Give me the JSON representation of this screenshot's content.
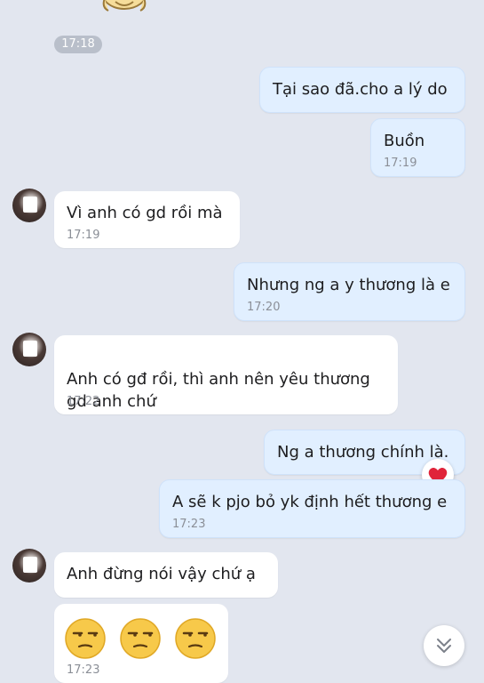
{
  "chat": {
    "top_time": "17:18",
    "messages": [
      {
        "side": "me",
        "text": "Tại sao đã.cho a lý do",
        "time": ""
      },
      {
        "side": "me",
        "text": "Buồn",
        "time": "17:19"
      },
      {
        "side": "them",
        "text": "Vì anh có gd rồi mà",
        "time": "17:19"
      },
      {
        "side": "me",
        "text": "Nhưng ng a y thương là e",
        "time": "17:20"
      },
      {
        "side": "them",
        "text": "Anh có gđ rồi, thì anh nên yêu thương\ngd anh chứ",
        "time": "17:22"
      },
      {
        "side": "me",
        "text": "Ng a thương chính là.",
        "time": "",
        "reaction": "heart-icon"
      },
      {
        "side": "me",
        "text": "A sẽ k pjo bỏ yk định hết thương e",
        "time": "17:23"
      },
      {
        "side": "them",
        "text": "Anh đừng nói vậy chứ ạ",
        "time": ""
      },
      {
        "side": "them",
        "text": "",
        "emojis": [
          "unamused-face-icon",
          "unamused-face-icon",
          "unamused-face-icon"
        ],
        "time": "17:23"
      }
    ]
  },
  "colors": {
    "background": "#e2e6ef",
    "outgoing_bubble": "#e1efff",
    "incoming_bubble": "#ffffff",
    "timestamp": "#8b8f97",
    "reaction_heart": "#e0243a"
  },
  "icons": {
    "scroll_down": "double-chevron-down-icon",
    "top_sticker": "sticker-icon"
  }
}
